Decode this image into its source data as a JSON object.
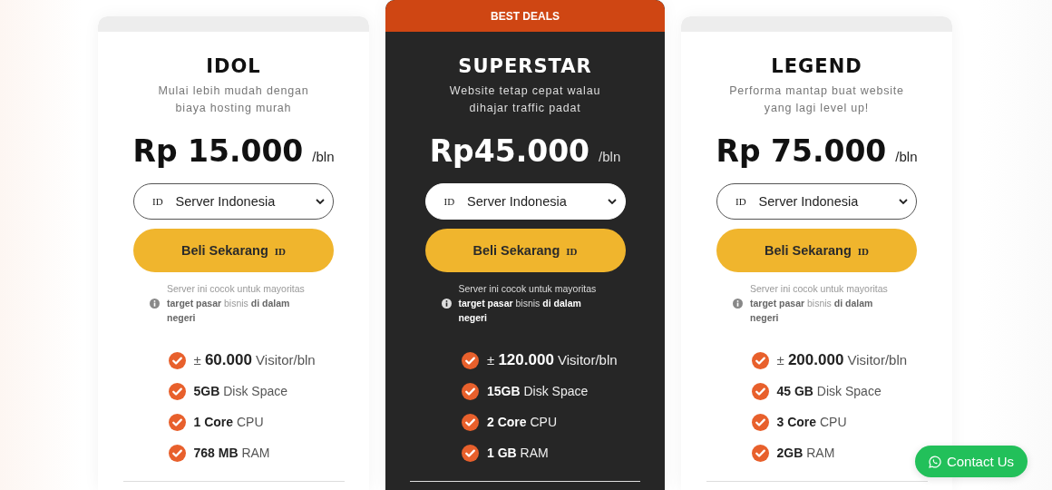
{
  "plans": [
    {
      "featured": false,
      "title": "IDOL",
      "subtitle": [
        "Mulai lebih mudah dengan",
        "biaya hosting murah"
      ],
      "price": "Rp 15.000",
      "period": "/bln",
      "server": {
        "flag": "ID",
        "label": "Server Indonesia"
      },
      "buy": {
        "label": "Beli Sekarang",
        "flag": "ID"
      },
      "note": "Server ini cocok untuk mayoritas **target pasar** bisnis **di dalam negeri**",
      "features": [
        {
          "kind": "big",
          "text": "± **60.000** Visitor/bln"
        },
        {
          "kind": "normal",
          "text": "**5GB** Disk Space"
        },
        {
          "kind": "normal",
          "text": "**1 Core** CPU"
        },
        {
          "kind": "normal",
          "text": "**768 MB** RAM"
        }
      ]
    },
    {
      "featured": true,
      "badge": "BEST DEALS",
      "title": "SUPERSTAR",
      "subtitle": [
        "Website tetap cepat walau",
        "dihajar traffic padat"
      ],
      "price": "Rp45.000",
      "period": "/bln",
      "server": {
        "flag": "ID",
        "label": "Server Indonesia"
      },
      "buy": {
        "label": "Beli Sekarang",
        "flag": "ID"
      },
      "note": "Server ini cocok untuk mayoritas **target pasar** bisnis **di dalam negeri**",
      "features": [
        {
          "kind": "big",
          "text": "± **120.000** Visitor/bln"
        },
        {
          "kind": "normal",
          "text": "**15GB** Disk Space"
        },
        {
          "kind": "normal",
          "text": "**2 Core** CPU"
        },
        {
          "kind": "normal",
          "text": "**1 GB** RAM"
        }
      ]
    },
    {
      "featured": false,
      "title": "LEGEND",
      "subtitle": [
        "Performa mantap buat website",
        "yang lagi level up!"
      ],
      "price": "Rp 75.000",
      "period": "/bln",
      "server": {
        "flag": "ID",
        "label": "Server Indonesia"
      },
      "buy": {
        "label": "Beli Sekarang",
        "flag": "ID"
      },
      "note": "Server ini cocok untuk mayoritas **target pasar** bisnis **di dalam negeri**",
      "features": [
        {
          "kind": "big",
          "text": "± **200.000** Visitor/bln"
        },
        {
          "kind": "normal",
          "text": "**45 GB** Disk Space"
        },
        {
          "kind": "normal",
          "text": "**3 Core** CPU"
        },
        {
          "kind": "normal",
          "text": "**2GB** RAM"
        }
      ]
    }
  ],
  "contact": {
    "label": "Contact Us"
  }
}
